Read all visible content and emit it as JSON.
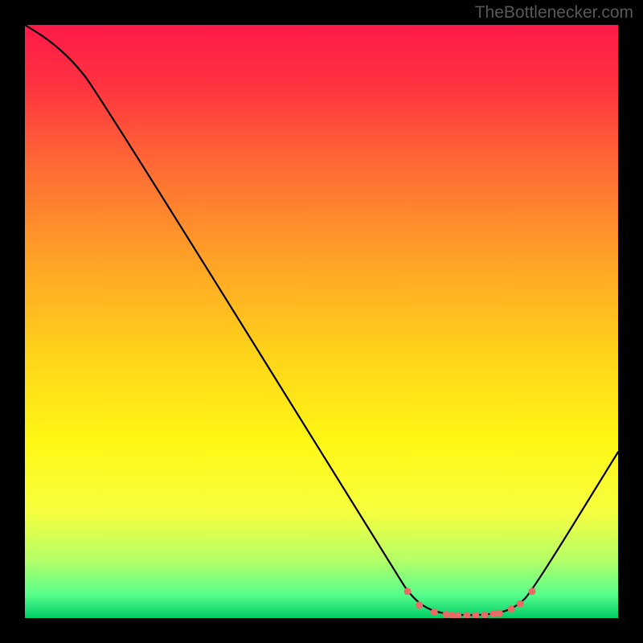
{
  "watermark": "TheBottlenecker.com",
  "chart_data": {
    "type": "line",
    "title": "",
    "xlabel": "",
    "ylabel": "",
    "xlim": [
      0,
      100
    ],
    "ylim": [
      0,
      100
    ],
    "gradient_stops": [
      {
        "offset": 0,
        "color": "#ff1a49"
      },
      {
        "offset": 0.1,
        "color": "#ff3240"
      },
      {
        "offset": 0.25,
        "color": "#ff6f33"
      },
      {
        "offset": 0.4,
        "color": "#ffa326"
      },
      {
        "offset": 0.55,
        "color": "#ffd21a"
      },
      {
        "offset": 0.7,
        "color": "#fff714"
      },
      {
        "offset": 0.82,
        "color": "#f7ff3f"
      },
      {
        "offset": 0.9,
        "color": "#b7ff66"
      },
      {
        "offset": 0.96,
        "color": "#58ff8c"
      },
      {
        "offset": 1.0,
        "color": "#00cc66"
      }
    ],
    "series": [
      {
        "name": "bottleneck-curve",
        "stroke": "#000000",
        "points": [
          {
            "x": 0.0,
            "y": 100.0
          },
          {
            "x": 4.0,
            "y": 97.5
          },
          {
            "x": 8.0,
            "y": 94.0
          },
          {
            "x": 12.0,
            "y": 89.0
          },
          {
            "x": 63.0,
            "y": 7.0
          },
          {
            "x": 64.5,
            "y": 4.5
          },
          {
            "x": 67.0,
            "y": 2.0
          },
          {
            "x": 70.0,
            "y": 0.8
          },
          {
            "x": 75.0,
            "y": 0.4
          },
          {
            "x": 80.0,
            "y": 0.8
          },
          {
            "x": 83.0,
            "y": 2.0
          },
          {
            "x": 85.5,
            "y": 4.5
          },
          {
            "x": 100.0,
            "y": 28.0
          }
        ]
      },
      {
        "name": "optimal-range-dots",
        "stroke": "#e86b66",
        "render": "dots",
        "points": [
          {
            "x": 64.5,
            "y": 4.5
          },
          {
            "x": 66.5,
            "y": 2.2
          },
          {
            "x": 69.0,
            "y": 1.0
          },
          {
            "x": 71.0,
            "y": 0.6
          },
          {
            "x": 72.0,
            "y": 0.5
          },
          {
            "x": 73.0,
            "y": 0.4
          },
          {
            "x": 74.5,
            "y": 0.4
          },
          {
            "x": 76.0,
            "y": 0.45
          },
          {
            "x": 77.5,
            "y": 0.55
          },
          {
            "x": 79.0,
            "y": 0.7
          },
          {
            "x": 80.0,
            "y": 0.8
          },
          {
            "x": 82.0,
            "y": 1.5
          },
          {
            "x": 83.5,
            "y": 2.4
          },
          {
            "x": 85.5,
            "y": 4.5
          }
        ]
      }
    ]
  }
}
